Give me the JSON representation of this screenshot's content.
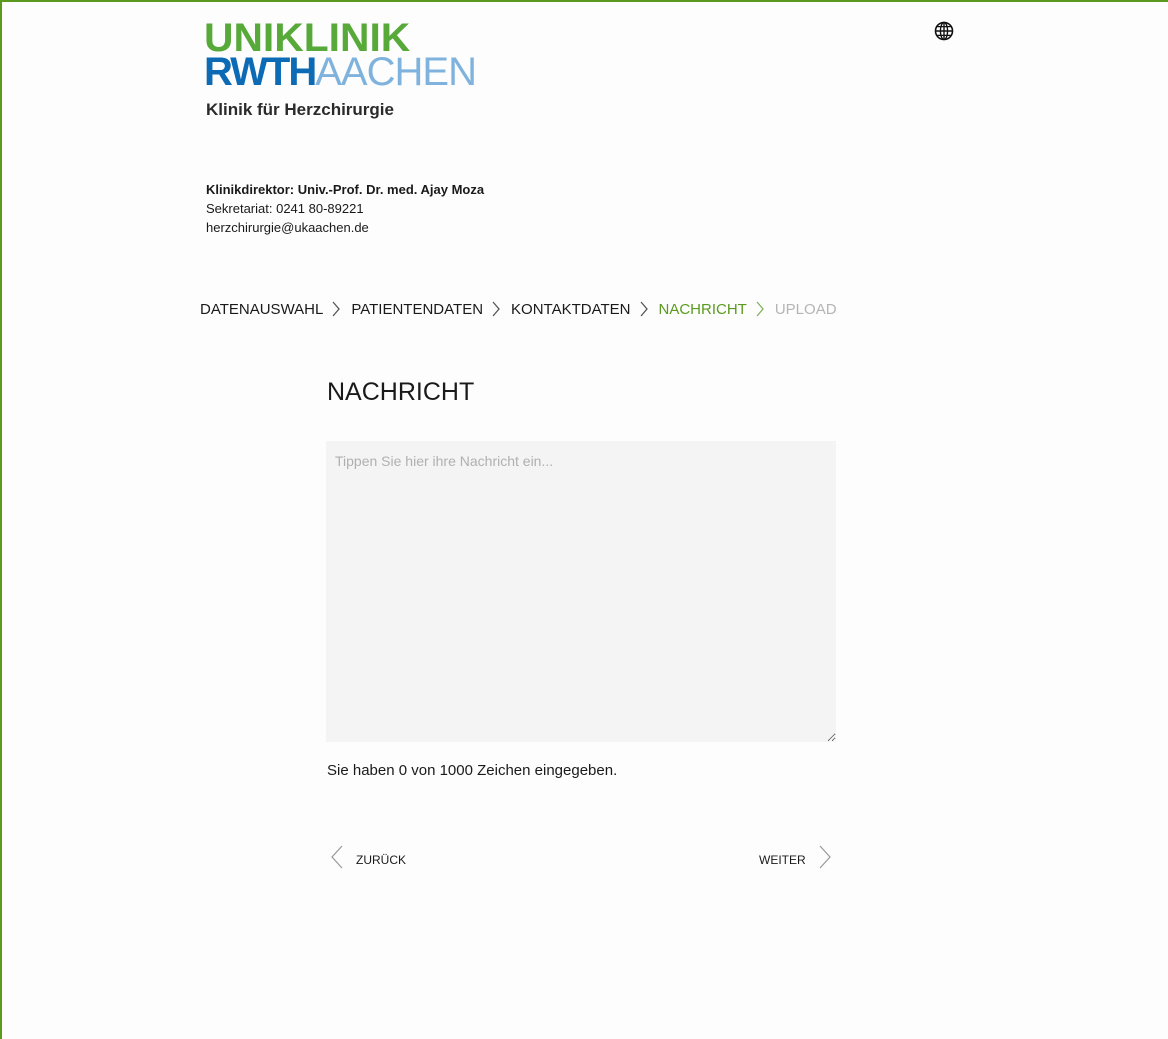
{
  "header": {
    "logo_line1": "UNIKLINIK",
    "logo_line2_bold": "RWTH",
    "logo_line2_light": "AACHEN",
    "clinic_name": "Klinik für Herzchirurgie",
    "language_icon": "globe-icon"
  },
  "contact": {
    "director": "Klinikdirektor: Univ.-Prof. Dr. med. Ajay Moza",
    "secretariat": "Sekretariat: 0241 80-89221",
    "email": "herzchirurgie@ukaachen.de"
  },
  "breadcrumb": {
    "steps": [
      {
        "label": "DATENAUSWAHL",
        "state": "done"
      },
      {
        "label": "PATIENTENDATEN",
        "state": "done"
      },
      {
        "label": "KONTAKTDATEN",
        "state": "done"
      },
      {
        "label": "NACHRICHT",
        "state": "active"
      },
      {
        "label": "UPLOAD",
        "state": "disabled"
      }
    ],
    "separator_icon": "chevron-right-icon"
  },
  "main": {
    "title": "NACHRICHT",
    "message_value": "",
    "message_placeholder": "Tippen Sie hier ihre Nachricht ein...",
    "counter_text": "Sie haben 0 von 1000 Zeichen eingegeben."
  },
  "navigation": {
    "back_label": "ZURÜCK",
    "next_label": "WEITER",
    "back_icon": "chevron-left-icon",
    "next_icon": "chevron-right-icon"
  },
  "colors": {
    "accent_green": "#5a9a1f",
    "logo_green": "#57a93a",
    "logo_blue": "#0d6bb5",
    "logo_light_blue": "#7fb3dd",
    "disabled_gray": "#b5b5b5",
    "textarea_bg": "#f4f4f4"
  }
}
